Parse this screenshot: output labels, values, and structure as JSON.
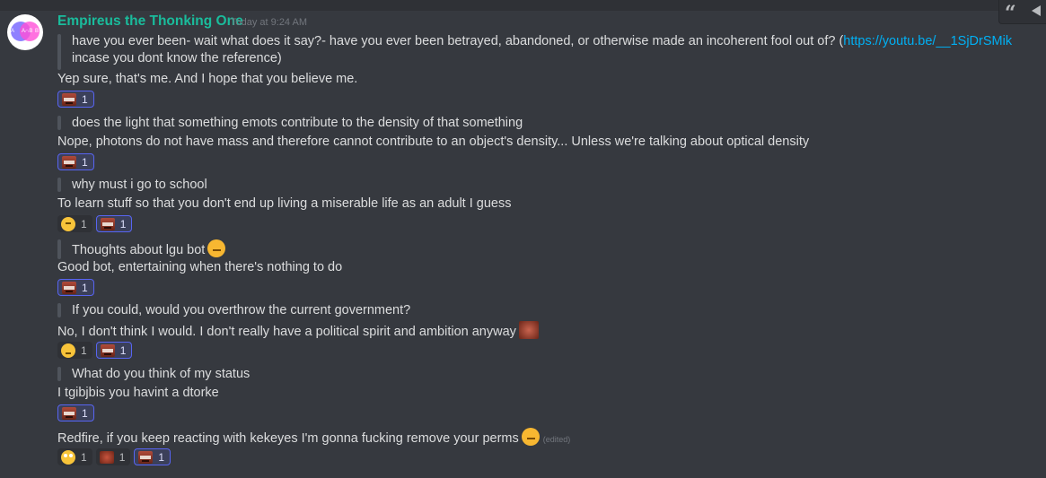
{
  "message": {
    "author": "Empireus the Thonking One",
    "timestamp": "Today at 9:24 AM",
    "avatar_letters": {
      "left": "A",
      "mid": "A∩B",
      "right": "B"
    },
    "edited_label": "(edited)"
  },
  "toolbar": {
    "quote_icon": "quote-icon",
    "more_icon": "more-icon"
  },
  "lines": {
    "q1a": "have you ever been- wait what does it say?- have you ever been betrayed, abandoned, or otherwise made an incoherent fool out of? (",
    "q1link": "https://youtu.be/__1SjDrSMik",
    "q1b": "incase you dont know the reference)",
    "a1": "Yep sure, that's me. And I hope that you believe me.",
    "q2": "does the light that something emots contribute to the density of that something",
    "a2": "Nope, photons do not have mass and therefore cannot contribute to an object's density... Unless we're talking about optical density",
    "q3": "why must i go to school",
    "a3": "To learn stuff so that you don't end up living a miserable life as an adult I guess",
    "q4": "Thoughts about lgu bot",
    "a4": "Good bot, entertaining when there's nothing to do",
    "q5": "If you could, would you overthrow the current government?",
    "a5": "No, I don't think I would. I don't really have a political spirit and ambition anyway",
    "q6": "What do you think of my status",
    "a6": "I tgibjbis you havint a dtorke",
    "last": "Redfire, if you keep reacting with kekeyes I'm gonna fucking remove your perms"
  },
  "reactions": {
    "r1": [
      {
        "icon": "kekeyes-emoji",
        "count": "1"
      }
    ],
    "r2": [
      {
        "icon": "kekeyes-emoji",
        "count": "1"
      }
    ],
    "r3": [
      {
        "icon": "thinking-emoji",
        "count": "1"
      },
      {
        "icon": "kekeyes-emoji",
        "count": "1"
      }
    ],
    "r4": [
      {
        "icon": "kekeyes-emoji",
        "count": "1"
      }
    ],
    "r5": [
      {
        "icon": "worried-emoji",
        "count": "1"
      },
      {
        "icon": "kekeyes-emoji",
        "count": "1"
      }
    ],
    "r6": [
      {
        "icon": "kekeyes-emoji",
        "count": "1"
      }
    ],
    "r7": [
      {
        "icon": "flushed-emoji",
        "count": "1"
      },
      {
        "icon": "eyes-emoji",
        "count": "1"
      },
      {
        "icon": "kekeyes-emoji",
        "count": "1"
      }
    ]
  }
}
